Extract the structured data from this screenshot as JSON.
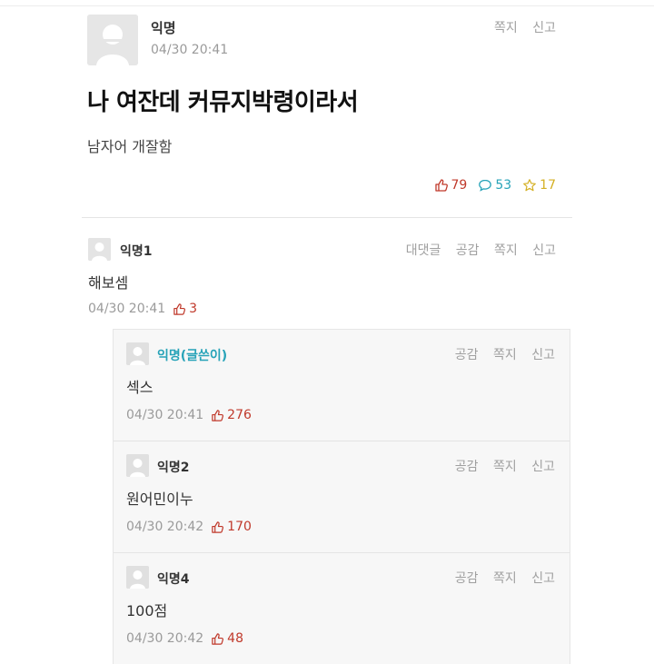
{
  "post": {
    "author": "익명",
    "date": "04/30 20:41",
    "actions": [
      "쪽지",
      "신고"
    ],
    "title": "나 여잔데 커뮤지박령이라서",
    "body": "남자어 개잘함",
    "stats": {
      "likes": "79",
      "comments": "53",
      "scraps": "17"
    }
  },
  "comment": {
    "author": "익명1",
    "actions": [
      "대댓글",
      "공감",
      "쪽지",
      "신고"
    ],
    "text": "해보셈",
    "date": "04/30 20:41",
    "votes": "3"
  },
  "replies": [
    {
      "author": "익명(글쓴이)",
      "actions": [
        "공감",
        "쪽지",
        "신고"
      ],
      "text": "섹스",
      "date": "04/30 20:41",
      "votes": "276"
    },
    {
      "author": "익명2",
      "actions": [
        "공감",
        "쪽지",
        "신고"
      ],
      "text": "원어민이누",
      "date": "04/30 20:42",
      "votes": "170"
    },
    {
      "author": "익명4",
      "actions": [
        "공감",
        "쪽지",
        "신고"
      ],
      "text": "100점",
      "date": "04/30 20:42",
      "votes": "48"
    }
  ],
  "colors": {
    "like": "#c0392b",
    "comment": "#27a3b8",
    "scrap": "#d4b024",
    "op_author": "#27a3b8"
  },
  "icons": {
    "like": "thumbs-up-icon",
    "comment": "speech-bubble-icon",
    "scrap": "star-icon",
    "avatar": "default-profile-avatar"
  }
}
